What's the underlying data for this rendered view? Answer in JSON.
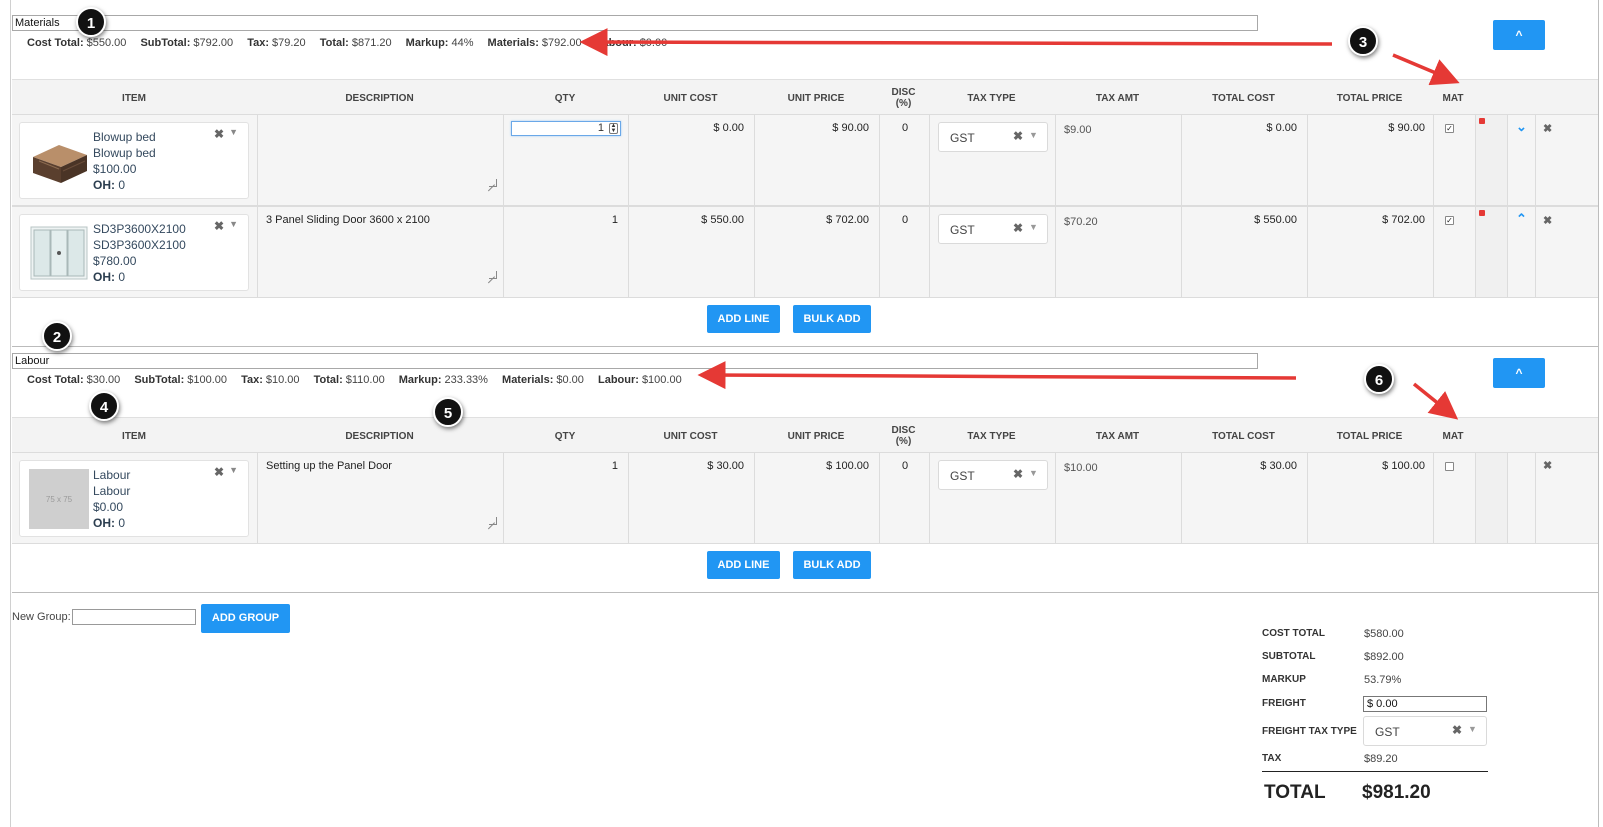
{
  "groups": [
    {
      "name": "Materials",
      "summary": {
        "cost_total_label": "Cost Total:",
        "cost_total": "$550.00",
        "subtotal_label": "SubTotal:",
        "subtotal": "$792.00",
        "tax_label": "Tax:",
        "tax": "$79.20",
        "total_label": "Total:",
        "total": "$871.20",
        "markup_label": "Markup:",
        "markup": "44%",
        "materials_label": "Materials:",
        "materials": "$792.00",
        "labour_label": "Labour:",
        "labour": "$0.00"
      },
      "collapse_label": "^",
      "rows": [
        {
          "item_name": "Blowup bed",
          "item_code": "Blowup bed",
          "item_price": "$100.00",
          "oh_label": "OH:",
          "oh_value": "0",
          "image": "air-mattress-image",
          "description": "",
          "qty": "1",
          "unit_cost": "$ 0.00",
          "unit_price": "$ 90.00",
          "disc": "0",
          "tax_type": "GST",
          "tax_amt": "$9.00",
          "total_cost": "$ 0.00",
          "total_price": "$ 90.00",
          "mat_checked": true,
          "move_direction": "down"
        },
        {
          "item_name": "SD3P3600X2100",
          "item_code": "SD3P3600X2100",
          "item_price": "$780.00",
          "oh_label": "OH:",
          "oh_value": "0",
          "image": "sliding-door-image",
          "description": "3 Panel Sliding Door 3600 x 2100",
          "qty": "1",
          "unit_cost": "$ 550.00",
          "unit_price": "$ 702.00",
          "disc": "0",
          "tax_type": "GST",
          "tax_amt": "$70.20",
          "total_cost": "$ 550.00",
          "total_price": "$ 702.00",
          "mat_checked": true,
          "move_direction": "up"
        }
      ],
      "add_line_label": "ADD LINE",
      "bulk_add_label": "BULK ADD"
    },
    {
      "name": "Labour",
      "summary": {
        "cost_total_label": "Cost Total:",
        "cost_total": "$30.00",
        "subtotal_label": "SubTotal:",
        "subtotal": "$100.00",
        "tax_label": "Tax:",
        "tax": "$10.00",
        "total_label": "Total:",
        "total": "$110.00",
        "markup_label": "Markup:",
        "markup": "233.33%",
        "materials_label": "Materials:",
        "materials": "$0.00",
        "labour_label": "Labour:",
        "labour": "$100.00"
      },
      "collapse_label": "^",
      "rows": [
        {
          "item_name": "Labour",
          "item_code": "Labour",
          "item_price": "$0.00",
          "oh_label": "OH:",
          "oh_value": "0",
          "image_placeholder": "75 x 75",
          "description": "Setting up the Panel Door",
          "qty": "1",
          "unit_cost": "$ 30.00",
          "unit_price": "$ 100.00",
          "disc": "0",
          "tax_type": "GST",
          "tax_amt": "$10.00",
          "total_cost": "$ 30.00",
          "total_price": "$ 100.00",
          "mat_checked": false
        }
      ],
      "add_line_label": "ADD LINE",
      "bulk_add_label": "BULK ADD"
    }
  ],
  "columns": {
    "item": "ITEM",
    "description": "DESCRIPTION",
    "qty": "QTY",
    "unit_cost": "UNIT COST",
    "unit_price": "UNIT PRICE",
    "disc_line1": "DISC",
    "disc_line2": "(%)",
    "tax_type": "TAX TYPE",
    "tax_amt": "TAX AMT",
    "total_cost": "TOTAL COST",
    "total_price": "TOTAL PRICE",
    "mat": "MAT"
  },
  "new_group": {
    "label": "New Group:",
    "value": "",
    "button": "ADD GROUP"
  },
  "totals": {
    "cost_total_label": "COST TOTAL",
    "cost_total": "$580.00",
    "subtotal_label": "SUBTOTAL",
    "subtotal": "$892.00",
    "markup_label": "MARKUP",
    "markup": "53.79%",
    "freight_label": "FREIGHT",
    "freight": "$ 0.00",
    "freight_tax_type_label": "FREIGHT TAX TYPE",
    "freight_tax_type": "GST",
    "tax_label": "TAX",
    "tax": "$89.20",
    "total_label": "TOTAL",
    "total": "$981.20"
  },
  "callouts": [
    "1",
    "2",
    "3",
    "4",
    "5",
    "6"
  ],
  "colors": {
    "accent": "#2196f3",
    "arrow": "#e53935",
    "callout": "#111111",
    "row_bg": "#f5f5f5"
  }
}
